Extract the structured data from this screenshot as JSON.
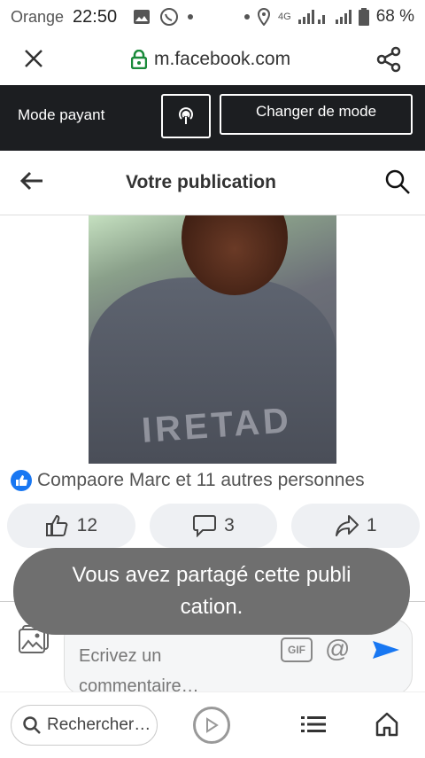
{
  "status_bar": {
    "carrier": "Orange",
    "time": "22:50",
    "network": "4G",
    "battery": "68 %"
  },
  "browser": {
    "url": "m.facebook.com"
  },
  "mode_bar": {
    "label": "Mode payant",
    "switch_label": "Changer de mode"
  },
  "header": {
    "title": "Votre publication"
  },
  "post": {
    "photo_print_text": "IRETAD",
    "reactions_text": "Compaore Marc et 11 autres personnes",
    "likes": "12",
    "comments": "3",
    "shares": "1"
  },
  "comment": {
    "placeholder": "Ecrivez un commentaire…",
    "gif_label": "GIF"
  },
  "toast": {
    "message": "Vous avez partagé cette publi cation."
  },
  "bottom_nav": {
    "search_label": "Rechercher…"
  },
  "colors": {
    "accent": "#1877f2",
    "dark_bar": "#1c1e21",
    "toast_bg": "#6f6f6f"
  }
}
